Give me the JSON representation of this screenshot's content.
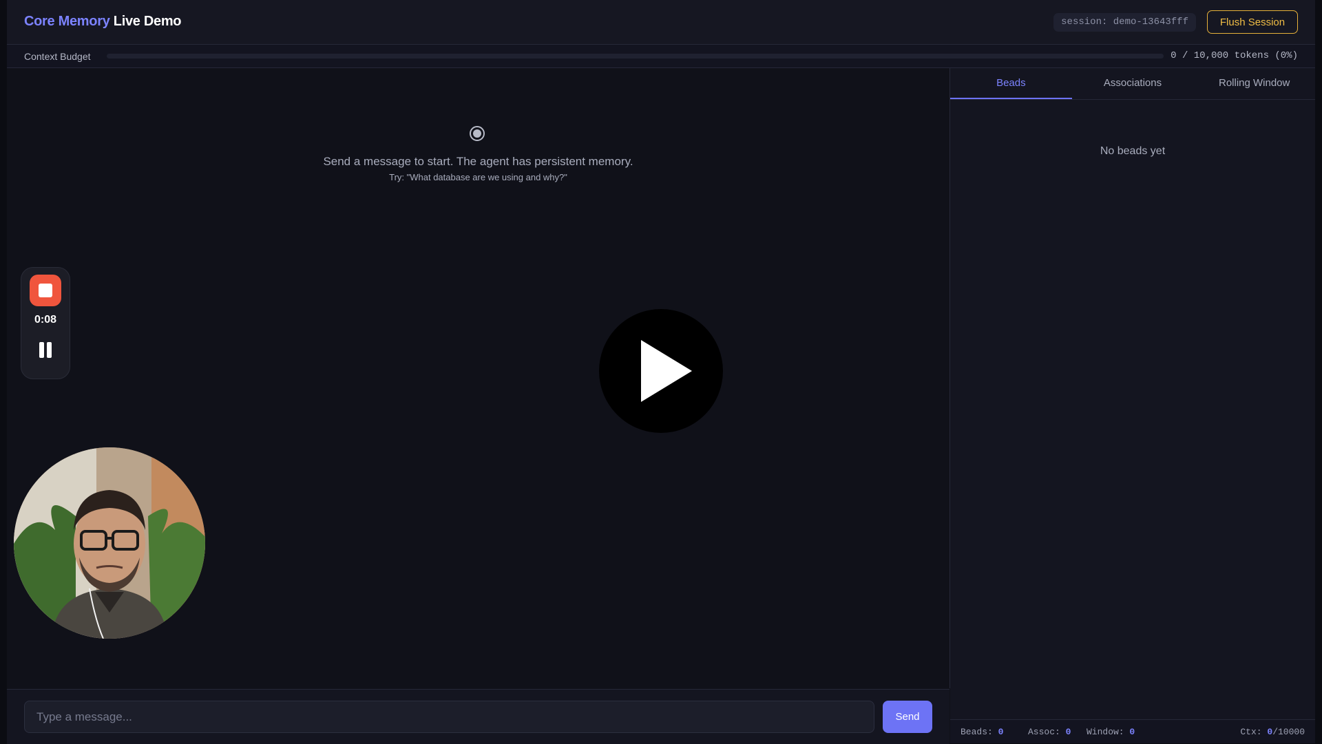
{
  "header": {
    "title_accent": "Core Memory",
    "title_rest": "Live Demo",
    "session": "session: demo-13643fff",
    "flush_label": "Flush Session"
  },
  "budget": {
    "label": "Context Budget",
    "value_text": "0 / 10,000 tokens (0%)",
    "used": 0,
    "total": 10000
  },
  "chat": {
    "empty_main": "Send a message to start. The agent has persistent memory.",
    "empty_hint": "Try: \"What database are we using and why?\"",
    "input_placeholder": "Type a message...",
    "send_label": "Send"
  },
  "recorder": {
    "elapsed": "0:08"
  },
  "panel": {
    "tabs": [
      "Beads",
      "Associations",
      "Rolling Window"
    ],
    "active_tab": "Beads",
    "empty_text": "No beads yet"
  },
  "stats": {
    "beads_label": "Beads:",
    "beads_value": "0",
    "assoc_label": "Assoc:",
    "assoc_value": "0",
    "window_label": "Window:",
    "window_value": "0",
    "ctx_label": "Ctx:",
    "ctx_value": "0",
    "ctx_total": "/10000"
  },
  "colors": {
    "accent": "#7c83ff",
    "flush": "#f0bd45",
    "record": "#f0553d",
    "background": "#111219"
  },
  "icons": [
    "radio-target-icon",
    "stop-icon",
    "pause-icon",
    "play-icon"
  ]
}
